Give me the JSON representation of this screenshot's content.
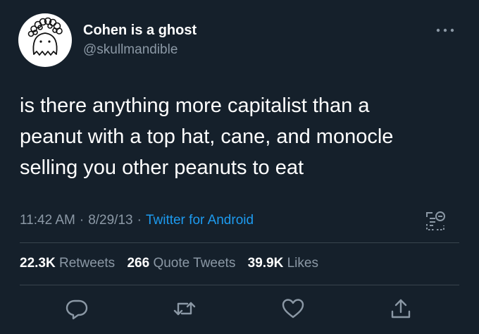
{
  "author": {
    "display_name": "Cohen is a ghost",
    "handle": "@skullmandible",
    "avatar_icon": "ghost-avatar"
  },
  "tweet": {
    "text": "is there anything more capitalist than a\npeanut with a top hat, cane, and monocle\nselling you other peanuts to eat"
  },
  "meta": {
    "time": "11:42 AM",
    "date": "8/29/13",
    "separator": "·",
    "source": "Twitter for Android"
  },
  "stats": {
    "retweets_count": "22.3K",
    "retweets_label": "Retweets",
    "quote_count": "266",
    "quote_label": "Quote Tweets",
    "likes_count": "39.9K",
    "likes_label": "Likes"
  },
  "icons": {
    "more": "more-dots-icon",
    "analytics": "analytics-icon",
    "reply": "reply-icon",
    "retweet": "retweet-icon",
    "like": "heart-icon",
    "share": "share-icon"
  },
  "colors": {
    "background": "#15202b",
    "text": "#ffffff",
    "secondary": "#8b98a5",
    "link": "#1d9bf0",
    "divider": "#38444d"
  }
}
